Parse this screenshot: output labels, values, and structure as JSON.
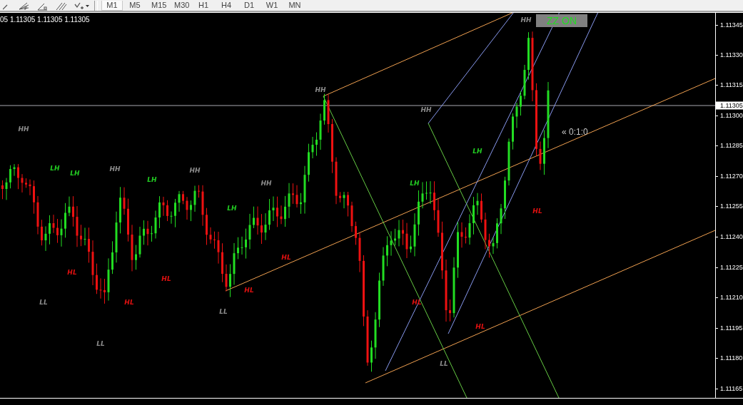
{
  "toolbar": {
    "timeframes": [
      {
        "label": "M1",
        "selected": true
      },
      {
        "label": "M5",
        "selected": false
      },
      {
        "label": "M15",
        "selected": false
      },
      {
        "label": "M30",
        "selected": false
      },
      {
        "label": "H1",
        "selected": false
      },
      {
        "label": "H4",
        "selected": false
      },
      {
        "label": "D1",
        "selected": false
      },
      {
        "label": "W1",
        "selected": false
      },
      {
        "label": "MN",
        "selected": false
      }
    ]
  },
  "chart": {
    "ohlc_header": "05 1.11305 1.11305 1.11305",
    "indicator_button": {
      "label": "ZZ ON"
    },
    "countdown": "« 0:1:0",
    "zigzag_labels": [
      {
        "text": "HH",
        "color": "#8c8c8c"
      },
      {
        "text": "LH",
        "color": "#22cc22"
      },
      {
        "text": "LH",
        "color": "#22cc22"
      },
      {
        "text": "HH",
        "color": "#8c8c8c"
      },
      {
        "text": "LH",
        "color": "#22cc22"
      },
      {
        "text": "HH",
        "color": "#8c8c8c"
      },
      {
        "text": "LH",
        "color": "#22cc22"
      },
      {
        "text": "HH",
        "color": "#8c8c8c"
      },
      {
        "text": "HH",
        "color": "#8c8c8c"
      },
      {
        "text": "HH",
        "color": "#8c8c8c"
      },
      {
        "text": "LH",
        "color": "#22cc22"
      },
      {
        "text": "LH",
        "color": "#22cc22"
      },
      {
        "text": "HH",
        "color": "#8c8c8c"
      },
      {
        "text": "HL",
        "color": "#e01010"
      },
      {
        "text": "HL",
        "color": "#e01010"
      },
      {
        "text": "HL",
        "color": "#e01010"
      },
      {
        "text": "HL",
        "color": "#e01010"
      },
      {
        "text": "HL",
        "color": "#e01010"
      },
      {
        "text": "HL",
        "color": "#e01010"
      },
      {
        "text": "HL",
        "color": "#e01010"
      },
      {
        "text": "HL",
        "color": "#e01010"
      },
      {
        "text": "LL",
        "color": "#8c8c8c"
      },
      {
        "text": "LL",
        "color": "#8c8c8c"
      },
      {
        "text": "LL",
        "color": "#8c8c8c"
      },
      {
        "text": "LL",
        "color": "#8c8c8c"
      }
    ]
  },
  "price_axis": {
    "ticks": [
      "1.11345",
      "1.11330",
      "1.11315",
      "1.11300",
      "1.11285",
      "1.11270",
      "1.11255",
      "1.11240",
      "1.11225",
      "1.11210",
      "1.11195",
      "1.11180",
      "1.11165"
    ],
    "current_price": "1.11305"
  }
}
